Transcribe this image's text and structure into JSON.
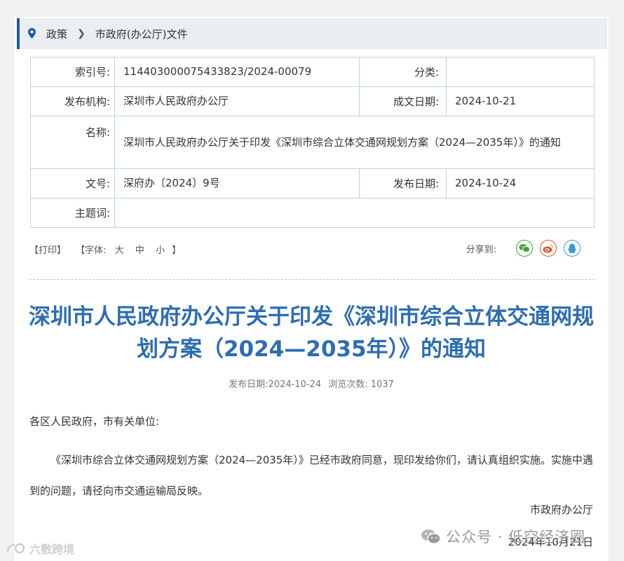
{
  "breadcrumb": {
    "root": "政策",
    "current": "市政府(办公厅)文件"
  },
  "info": {
    "index_label": "索引号:",
    "index_value": "114403000075433823/2024-00079",
    "category_label": "分类:",
    "category_value": "",
    "publisher_label": "发布机构:",
    "publisher_value": "深圳市人民政府办公厅",
    "written_label": "成文日期:",
    "written_value": "2024-10-21",
    "name_label": "名称:",
    "name_value": "深圳市人民政府办公厅关于印发《深圳市综合立体交通网规划方案（2024—2035年）》的通知",
    "docno_label": "文号:",
    "docno_value": "深府办〔2024〕9号",
    "pubdate_label": "发布日期:",
    "pubdate_value": "2024-10-24",
    "keywords_label": "主题词:",
    "keywords_value": ""
  },
  "tools": {
    "print": "【打印】",
    "font_prefix": "【字体:",
    "font_large": "大",
    "font_medium": "中",
    "font_small": "小",
    "font_suffix": "】",
    "share_label": "分享到:"
  },
  "article": {
    "title": "深圳市人民政府办公厅关于印发《深圳市综合立体交通网规划方案（2024—2035年）》的通知",
    "meta_date": "发布日期:2024-10-24",
    "meta_views": "浏览次数: 1037",
    "salutation": "各区人民政府，市有关单位:",
    "paragraph": "《深圳市综合立体交通网规划方案（2024—2035年）》已经市政府同意，现印发给你们，请认真组织实施。实施中遇到的问题，请径向市交通运输局反映。",
    "signature": "市政府办公厅",
    "date": "2024年10月21日"
  },
  "watermarks": {
    "wechat": "公众号 · 低空经济圈",
    "corner": "六敷跨境"
  },
  "colors": {
    "accent": "#1f5aa6",
    "title": "#2d6db1",
    "wechat": "#3aa535",
    "weibo": "#e0542a",
    "qq": "#3a9ad8"
  }
}
